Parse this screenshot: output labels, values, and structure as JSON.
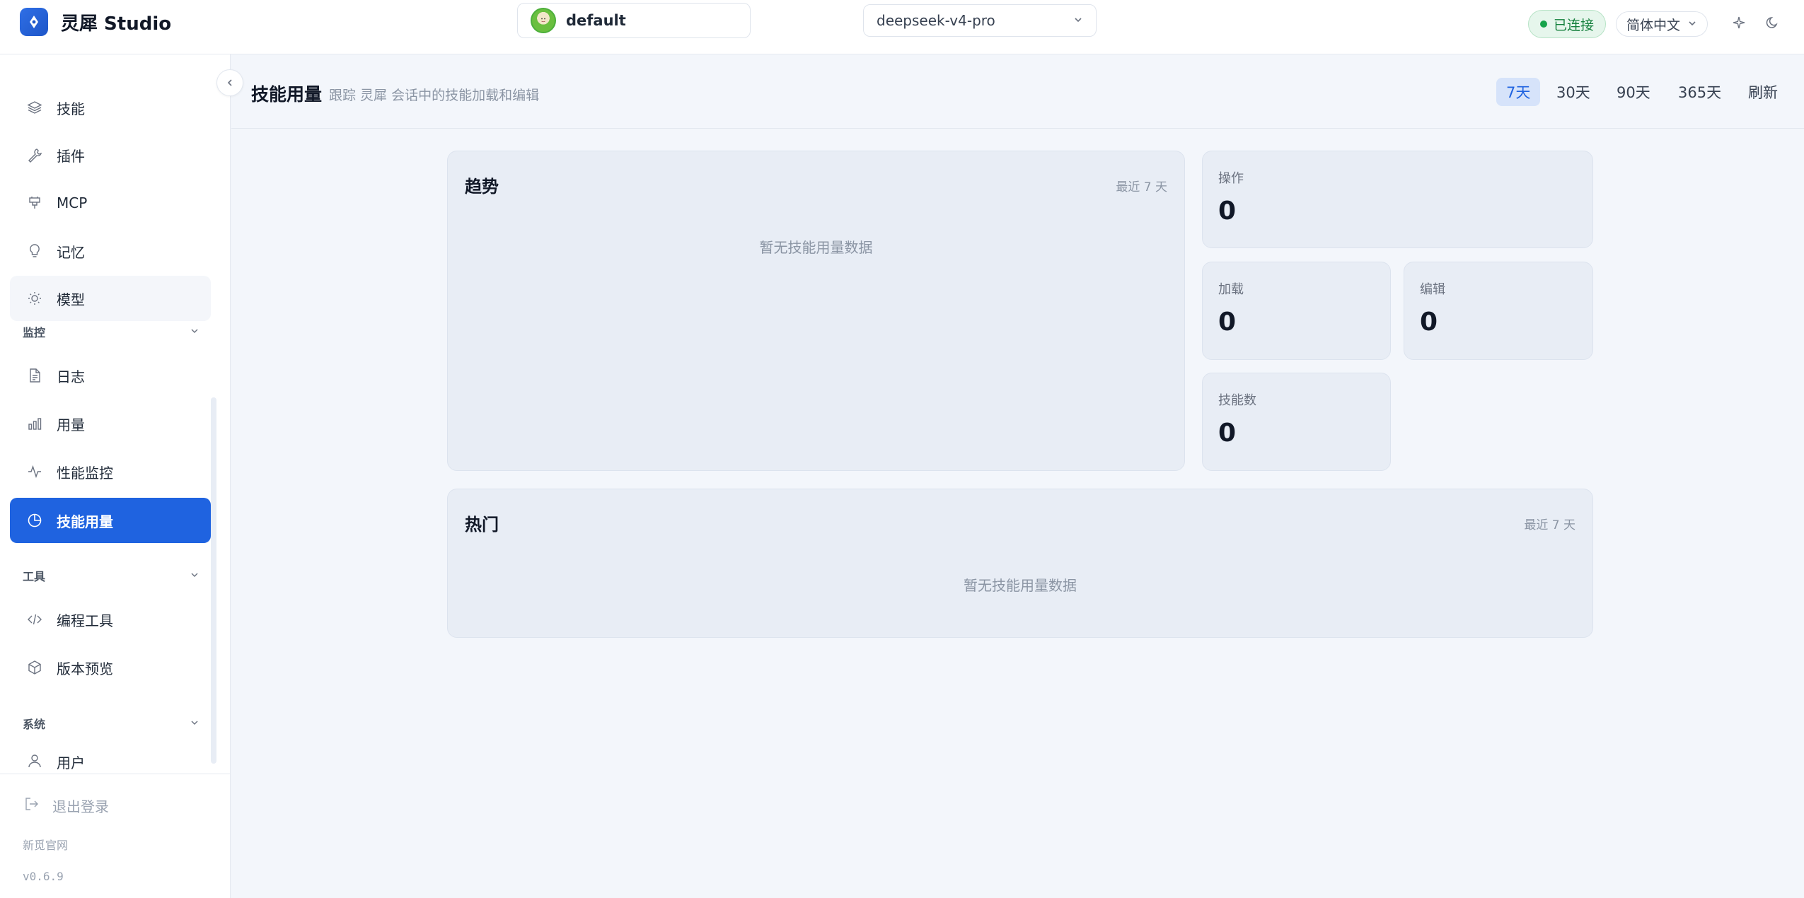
{
  "app": {
    "title": "灵犀 Studio"
  },
  "header": {
    "user": "default",
    "model": "deepseek-v4-pro",
    "status": "已连接",
    "language": "简体中文"
  },
  "sidebar": {
    "items_top": [
      {
        "label": "技能",
        "icon": "layers-icon"
      },
      {
        "label": "插件",
        "icon": "wrench-icon"
      },
      {
        "label": "MCP",
        "icon": "plug-icon"
      },
      {
        "label": "记忆",
        "icon": "lightbulb-icon"
      },
      {
        "label": "模型",
        "icon": "sun-icon"
      }
    ],
    "section_monitor": "监控",
    "items_monitor": [
      {
        "label": "日志",
        "icon": "file-icon"
      },
      {
        "label": "用量",
        "icon": "bar-chart-icon"
      },
      {
        "label": "性能监控",
        "icon": "activity-icon"
      },
      {
        "label": "技能用量",
        "icon": "pie-chart-icon"
      }
    ],
    "section_tools": "工具",
    "items_tools": [
      {
        "label": "编程工具",
        "icon": "code-icon"
      },
      {
        "label": "版本预览",
        "icon": "package-icon"
      }
    ],
    "section_system": "系统",
    "items_system": [
      {
        "label": "用户",
        "icon": "user-icon"
      }
    ],
    "logout": "退出登录",
    "footer_link": "新觅官网",
    "version": "v0.6.9"
  },
  "page": {
    "title": "技能用量",
    "subtitle": "跟踪 灵犀 会话中的技能加载和编辑",
    "ranges": [
      "7天",
      "30天",
      "90天",
      "365天"
    ],
    "active_range": "7天",
    "refresh": "刷新"
  },
  "trend_card": {
    "title": "趋势",
    "range": "最近 7 天",
    "empty": "暂无技能用量数据"
  },
  "popular_card": {
    "title": "热门",
    "range": "最近 7 天",
    "empty": "暂无技能用量数据"
  },
  "stats": {
    "operations": {
      "label": "操作",
      "value": "0"
    },
    "loads": {
      "label": "加载",
      "value": "0"
    },
    "edits": {
      "label": "编辑",
      "value": "0"
    },
    "skills": {
      "label": "技能数",
      "value": "0"
    }
  },
  "colors": {
    "accent": "#1f63e0",
    "success": "#16a34a",
    "card_bg": "#e8edf5"
  }
}
